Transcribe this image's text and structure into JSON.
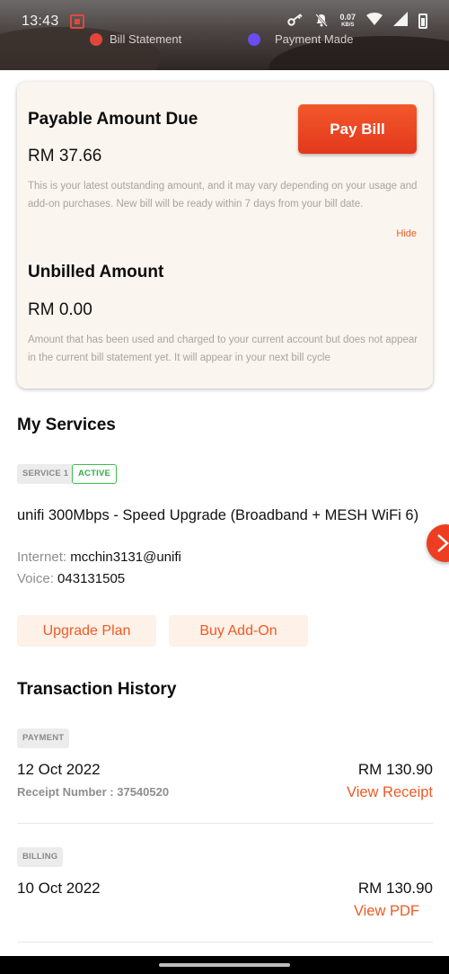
{
  "status_bar": {
    "time": "13:43",
    "speed_value": "0.07",
    "speed_unit": "KB/S"
  },
  "legend": {
    "item1": "Bill Statement",
    "item2": "Payment Made"
  },
  "amount_card": {
    "payable_title": "Payable Amount Due",
    "payable_amount": "RM 37.66",
    "pay_button": "Pay Bill",
    "payable_description": "This is your latest outstanding amount, and it may vary depending on your usage and add-on purchases. New bill will be ready within 7 days from your bill date.",
    "hide_label": "Hide",
    "unbilled_title": "Unbilled Amount",
    "unbilled_amount": "RM 0.00",
    "unbilled_description": "Amount that has been used and charged to your current account but does not appear in the current bill statement yet. It will appear in your next bill cycle"
  },
  "services": {
    "title": "My Services",
    "service_tag": "SERVICE 1",
    "status_tag": "ACTIVE",
    "plan_name": "unifi 300Mbps - Speed Upgrade (Broadband + MESH WiFi 6)",
    "internet_label": "Internet:",
    "internet_value": "mcchin3131@unifi",
    "voice_label": "Voice:",
    "voice_value": "043131505",
    "upgrade_button": "Upgrade Plan",
    "addon_button": "Buy Add-On"
  },
  "transactions": {
    "title": "Transaction History",
    "items": [
      {
        "type": "PAYMENT",
        "date": "12 Oct 2022",
        "amount": "RM 130.90",
        "receipt": "Receipt Number : 37540520",
        "action": "View Receipt"
      },
      {
        "type": "BILLING",
        "date": "10 Oct 2022",
        "amount": "RM 130.90",
        "action": "View PDF"
      }
    ]
  },
  "colors": {
    "accent": "#ef5a24",
    "card_bg": "#fbf5ef",
    "active_green": "#3fbf4d"
  },
  "icons": [
    "key-icon",
    "bell-off-icon",
    "wifi-icon",
    "signal-icon",
    "battery-icon",
    "chevron-right-icon"
  ]
}
